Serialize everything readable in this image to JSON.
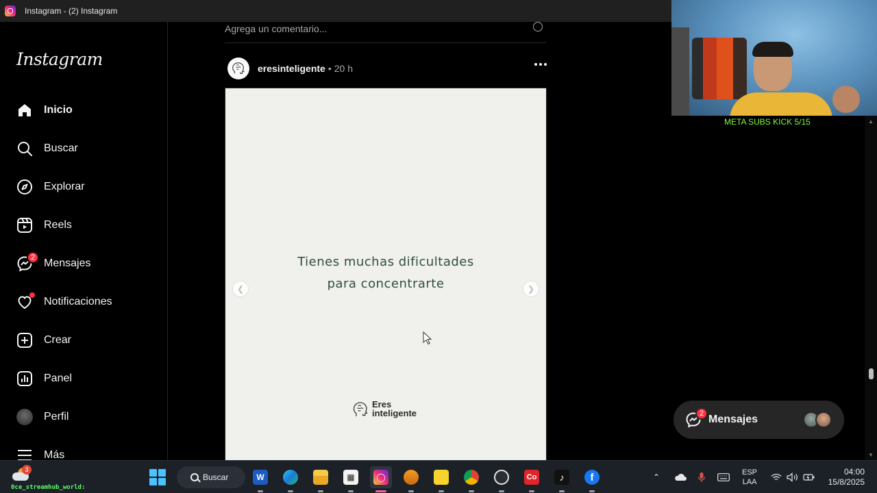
{
  "window": {
    "title": "Instagram - (2) Instagram"
  },
  "sidebar": {
    "logo": "Instagram",
    "items": [
      {
        "label": "Inicio",
        "icon": "home-icon",
        "active": true
      },
      {
        "label": "Buscar",
        "icon": "search-icon"
      },
      {
        "label": "Explorar",
        "icon": "compass-icon"
      },
      {
        "label": "Reels",
        "icon": "reels-icon"
      },
      {
        "label": "Mensajes",
        "icon": "messenger-icon",
        "badge": "2"
      },
      {
        "label": "Notificaciones",
        "icon": "heart-icon",
        "dot": true
      },
      {
        "label": "Crear",
        "icon": "plus-square-icon"
      },
      {
        "label": "Panel",
        "icon": "dashboard-icon"
      },
      {
        "label": "Perfil",
        "icon": "avatar"
      },
      {
        "label": "Más",
        "icon": "menu-icon"
      }
    ]
  },
  "feed": {
    "comment_placeholder": "Agrega un comentario...",
    "post": {
      "username": "eresinteligente",
      "separator": "•",
      "time": "20 h",
      "image_text_line1": "Tienes muchas dificultades",
      "image_text_line2": "para concentrarte",
      "brand_line1": "Eres",
      "brand_line2": "inteligente"
    }
  },
  "overlay": {
    "meta_text": "META SUBS KICK 5/15"
  },
  "messages_pill": {
    "label": "Mensajes",
    "badge": "2"
  },
  "taskbar": {
    "weather_badge": "3",
    "streamer_tag": "0ce_streamhub_world:",
    "search_label": "Buscar",
    "lang_line1": "ESP",
    "lang_line2": "LAA",
    "time": "04:00",
    "date": "15/8/2025"
  },
  "colors": {
    "accent_badge": "#ff3040",
    "image_bg": "#f0f0ed",
    "image_text": "#2f4f3c",
    "overlay_text": "#7cff3a"
  }
}
